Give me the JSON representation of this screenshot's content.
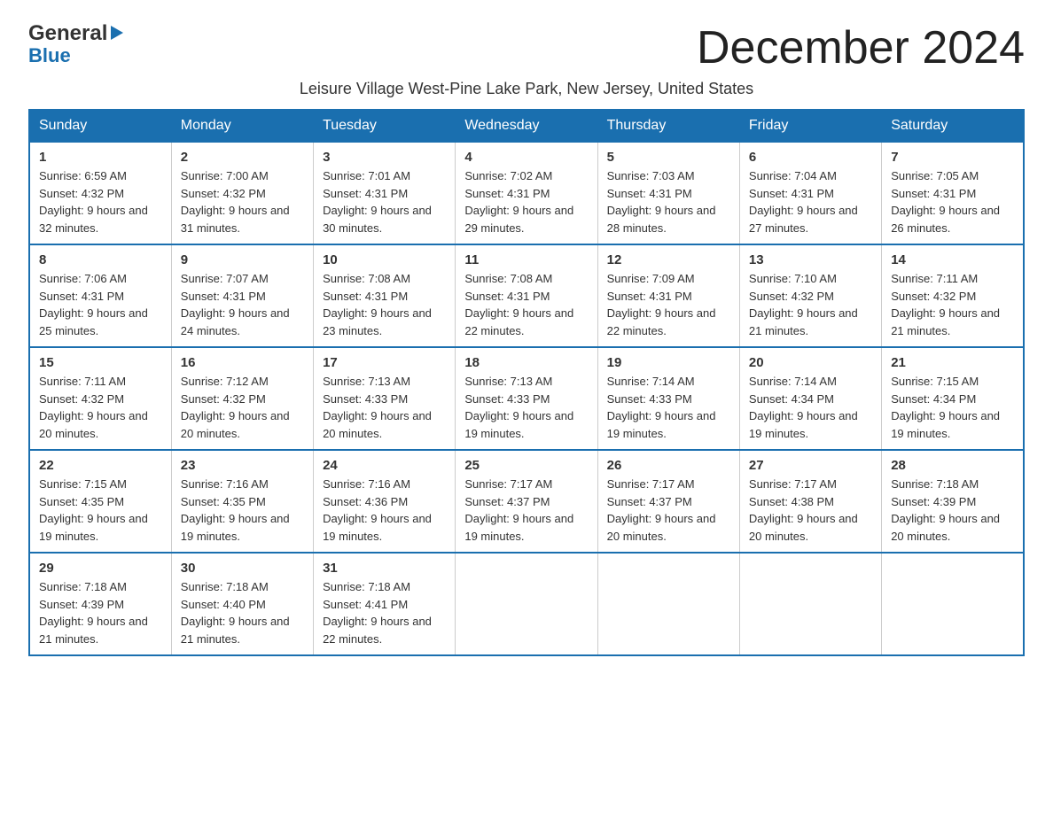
{
  "logo": {
    "line1": "General",
    "arrow": "▶",
    "line2": "Blue"
  },
  "title": "December 2024",
  "subtitle": "Leisure Village West-Pine Lake Park, New Jersey, United States",
  "weekdays": [
    "Sunday",
    "Monday",
    "Tuesday",
    "Wednesday",
    "Thursday",
    "Friday",
    "Saturday"
  ],
  "weeks": [
    [
      {
        "day": "1",
        "sunrise": "6:59 AM",
        "sunset": "4:32 PM",
        "daylight": "9 hours and 32 minutes."
      },
      {
        "day": "2",
        "sunrise": "7:00 AM",
        "sunset": "4:32 PM",
        "daylight": "9 hours and 31 minutes."
      },
      {
        "day": "3",
        "sunrise": "7:01 AM",
        "sunset": "4:31 PM",
        "daylight": "9 hours and 30 minutes."
      },
      {
        "day": "4",
        "sunrise": "7:02 AM",
        "sunset": "4:31 PM",
        "daylight": "9 hours and 29 minutes."
      },
      {
        "day": "5",
        "sunrise": "7:03 AM",
        "sunset": "4:31 PM",
        "daylight": "9 hours and 28 minutes."
      },
      {
        "day": "6",
        "sunrise": "7:04 AM",
        "sunset": "4:31 PM",
        "daylight": "9 hours and 27 minutes."
      },
      {
        "day": "7",
        "sunrise": "7:05 AM",
        "sunset": "4:31 PM",
        "daylight": "9 hours and 26 minutes."
      }
    ],
    [
      {
        "day": "8",
        "sunrise": "7:06 AM",
        "sunset": "4:31 PM",
        "daylight": "9 hours and 25 minutes."
      },
      {
        "day": "9",
        "sunrise": "7:07 AM",
        "sunset": "4:31 PM",
        "daylight": "9 hours and 24 minutes."
      },
      {
        "day": "10",
        "sunrise": "7:08 AM",
        "sunset": "4:31 PM",
        "daylight": "9 hours and 23 minutes."
      },
      {
        "day": "11",
        "sunrise": "7:08 AM",
        "sunset": "4:31 PM",
        "daylight": "9 hours and 22 minutes."
      },
      {
        "day": "12",
        "sunrise": "7:09 AM",
        "sunset": "4:31 PM",
        "daylight": "9 hours and 22 minutes."
      },
      {
        "day": "13",
        "sunrise": "7:10 AM",
        "sunset": "4:32 PM",
        "daylight": "9 hours and 21 minutes."
      },
      {
        "day": "14",
        "sunrise": "7:11 AM",
        "sunset": "4:32 PM",
        "daylight": "9 hours and 21 minutes."
      }
    ],
    [
      {
        "day": "15",
        "sunrise": "7:11 AM",
        "sunset": "4:32 PM",
        "daylight": "9 hours and 20 minutes."
      },
      {
        "day": "16",
        "sunrise": "7:12 AM",
        "sunset": "4:32 PM",
        "daylight": "9 hours and 20 minutes."
      },
      {
        "day": "17",
        "sunrise": "7:13 AM",
        "sunset": "4:33 PM",
        "daylight": "9 hours and 20 minutes."
      },
      {
        "day": "18",
        "sunrise": "7:13 AM",
        "sunset": "4:33 PM",
        "daylight": "9 hours and 19 minutes."
      },
      {
        "day": "19",
        "sunrise": "7:14 AM",
        "sunset": "4:33 PM",
        "daylight": "9 hours and 19 minutes."
      },
      {
        "day": "20",
        "sunrise": "7:14 AM",
        "sunset": "4:34 PM",
        "daylight": "9 hours and 19 minutes."
      },
      {
        "day": "21",
        "sunrise": "7:15 AM",
        "sunset": "4:34 PM",
        "daylight": "9 hours and 19 minutes."
      }
    ],
    [
      {
        "day": "22",
        "sunrise": "7:15 AM",
        "sunset": "4:35 PM",
        "daylight": "9 hours and 19 minutes."
      },
      {
        "day": "23",
        "sunrise": "7:16 AM",
        "sunset": "4:35 PM",
        "daylight": "9 hours and 19 minutes."
      },
      {
        "day": "24",
        "sunrise": "7:16 AM",
        "sunset": "4:36 PM",
        "daylight": "9 hours and 19 minutes."
      },
      {
        "day": "25",
        "sunrise": "7:17 AM",
        "sunset": "4:37 PM",
        "daylight": "9 hours and 19 minutes."
      },
      {
        "day": "26",
        "sunrise": "7:17 AM",
        "sunset": "4:37 PM",
        "daylight": "9 hours and 20 minutes."
      },
      {
        "day": "27",
        "sunrise": "7:17 AM",
        "sunset": "4:38 PM",
        "daylight": "9 hours and 20 minutes."
      },
      {
        "day": "28",
        "sunrise": "7:18 AM",
        "sunset": "4:39 PM",
        "daylight": "9 hours and 20 minutes."
      }
    ],
    [
      {
        "day": "29",
        "sunrise": "7:18 AM",
        "sunset": "4:39 PM",
        "daylight": "9 hours and 21 minutes."
      },
      {
        "day": "30",
        "sunrise": "7:18 AM",
        "sunset": "4:40 PM",
        "daylight": "9 hours and 21 minutes."
      },
      {
        "day": "31",
        "sunrise": "7:18 AM",
        "sunset": "4:41 PM",
        "daylight": "9 hours and 22 minutes."
      },
      null,
      null,
      null,
      null
    ]
  ]
}
